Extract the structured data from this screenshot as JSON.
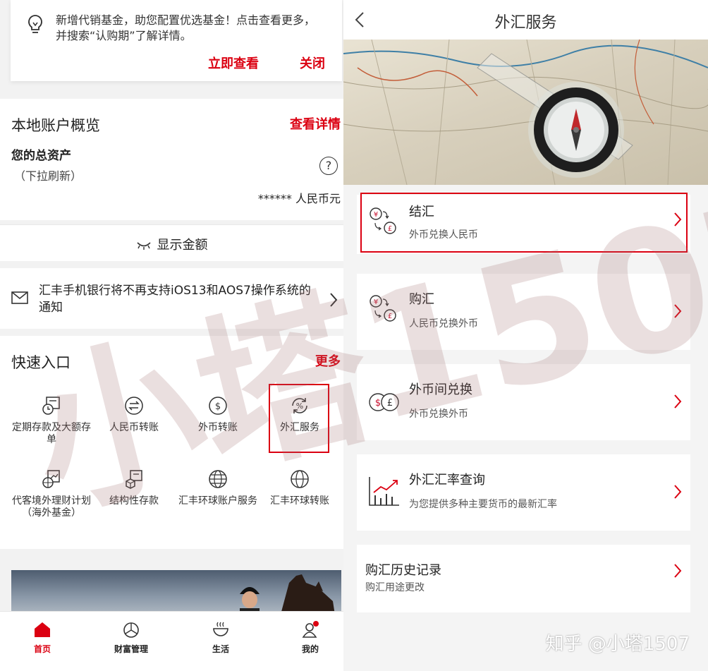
{
  "left": {
    "notice": {
      "text": "新增代销基金，助您配置优选基金！点击查看更多，并搜索“认购期”了解详情。",
      "view_label": "立即查看",
      "close_label": "关闭"
    },
    "overview": {
      "title": "本地账户概览",
      "detail_link": "查看详情",
      "assets_label": "您的总资产",
      "refresh_hint": "（下拉刷新）",
      "help": "?",
      "amount": "****** 人民币元"
    },
    "show_amount_label": "显示金额",
    "message": "汇丰手机银行将不再支持iOS13和AOS7操作系统的通知",
    "quick": {
      "title": "快速入口",
      "more_label": "更多",
      "items": [
        {
          "label": "定期存款及大额存单",
          "icon": "time-deposit-icon"
        },
        {
          "label": "人民币转账",
          "icon": "rmb-transfer-icon"
        },
        {
          "label": "外币转账",
          "icon": "foreign-transfer-icon"
        },
        {
          "label": "外汇服务",
          "icon": "fx-service-icon"
        },
        {
          "label": "代客境外理财计划（海外基金）",
          "icon": "overseas-fund-icon"
        },
        {
          "label": "结构性存款",
          "icon": "structured-deposit-icon"
        },
        {
          "label": "汇丰环球账户服务",
          "icon": "global-account-icon"
        },
        {
          "label": "汇丰环球转账",
          "icon": "global-transfer-icon"
        }
      ]
    },
    "tabs": [
      {
        "label": "首页",
        "icon": "home-icon"
      },
      {
        "label": "财富管理",
        "icon": "wealth-icon"
      },
      {
        "label": "生活",
        "icon": "life-icon"
      },
      {
        "label": "我的",
        "icon": "profile-icon"
      }
    ]
  },
  "right": {
    "title": "外汇服务",
    "items": [
      {
        "title": "结汇",
        "subtitle": "外币兑换人民币",
        "icon": "fx-to-rmb-icon"
      },
      {
        "title": "购汇",
        "subtitle": "人民币兑换外币",
        "icon": "rmb-to-fx-icon"
      },
      {
        "title": "外币间兑换",
        "subtitle": "外币兑换外币",
        "icon": "fx-exchange-icon"
      },
      {
        "title": "外汇汇率查询",
        "subtitle": "为您提供多种主要货币的最新汇率",
        "icon": "rate-chart-icon"
      },
      {
        "title": "购汇历史记录",
        "subtitle": "购汇用途更改"
      }
    ]
  },
  "watermark": "小塔1507",
  "credit": "知乎 @小塔1507",
  "colors": {
    "accent": "#db0011"
  }
}
